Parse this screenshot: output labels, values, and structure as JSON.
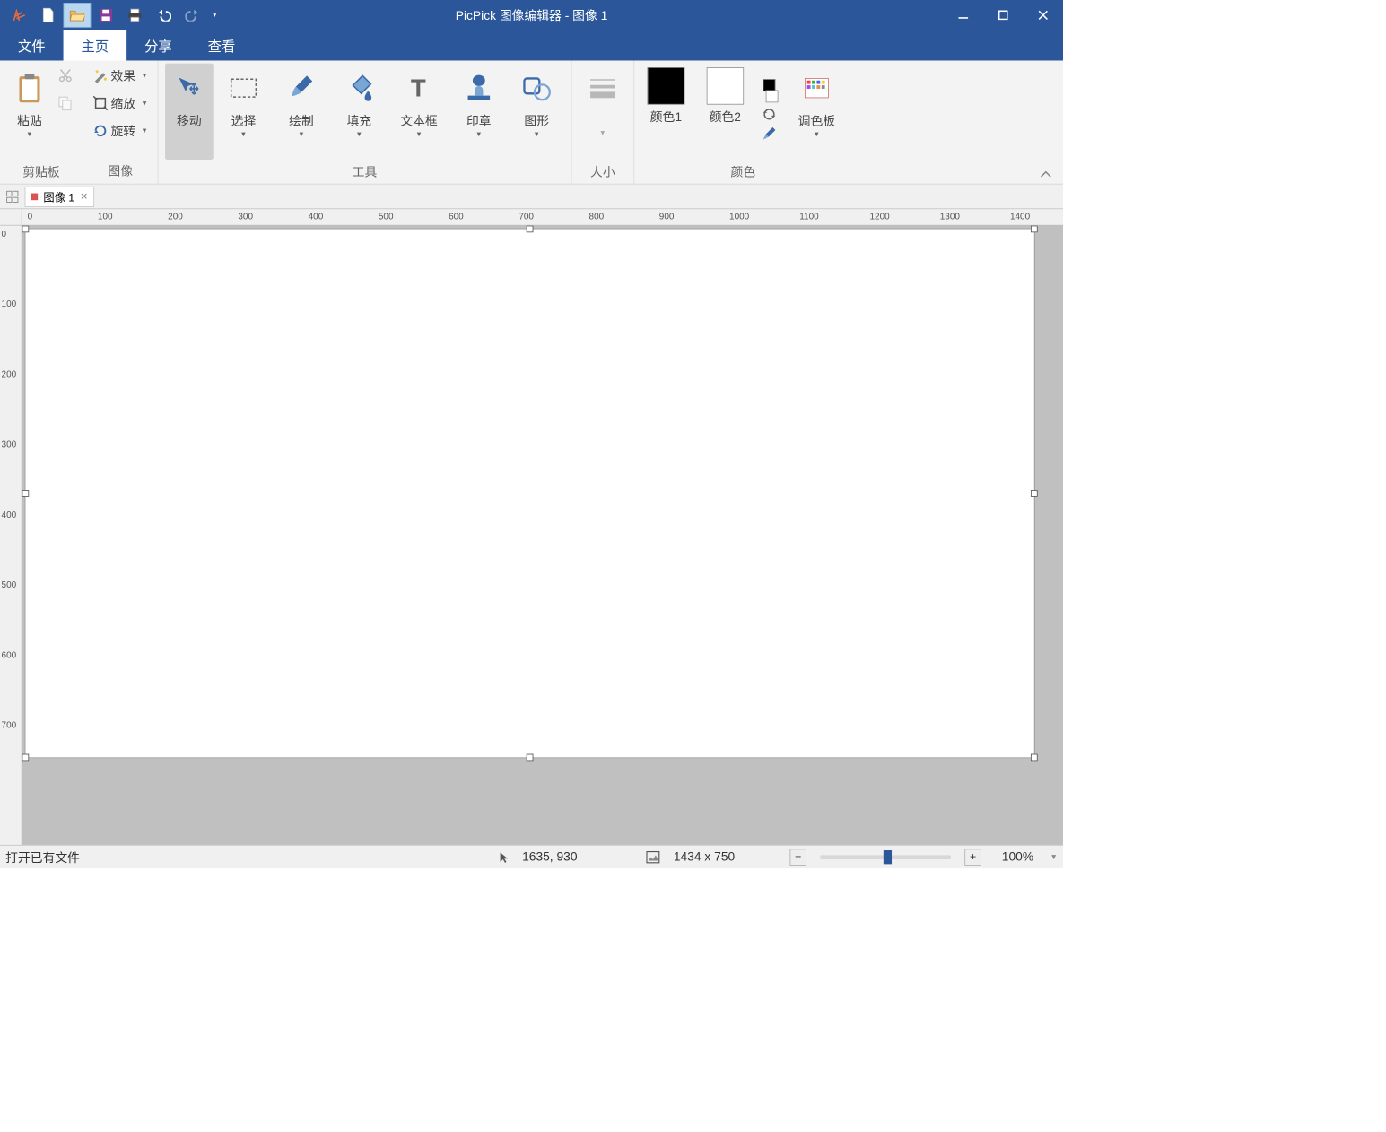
{
  "window": {
    "title": "PicPick 图像编辑器 - 图像 1"
  },
  "tabs": {
    "file": "文件",
    "home": "主页",
    "share": "分享",
    "view": "查看"
  },
  "ribbon": {
    "clipboard": {
      "paste": "粘贴",
      "group": "剪贴板"
    },
    "image": {
      "effects": "效果",
      "scale": "缩放",
      "rotate": "旋转",
      "group": "图像"
    },
    "tools": {
      "move": "移动",
      "select": "选择",
      "draw": "绘制",
      "fill": "填充",
      "textbox": "文本框",
      "stamp": "印章",
      "shape": "图形",
      "group": "工具"
    },
    "size": {
      "group": "大小"
    },
    "color": {
      "c1": "颜色1",
      "c2": "颜色2",
      "palette": "调色板",
      "group": "颜色"
    }
  },
  "doc_tab": {
    "label": "图像 1"
  },
  "status": {
    "hint": "打开已有文件",
    "cursor": "1635, 930",
    "dim": "1434 x 750",
    "zoom": "100%"
  },
  "ruler_h": [
    "0",
    "100",
    "200",
    "300",
    "400",
    "500",
    "600",
    "700",
    "800",
    "900",
    "1000",
    "1100",
    "1200",
    "1300",
    "1400"
  ],
  "ruler_v": [
    "0",
    "100",
    "200",
    "300",
    "400",
    "500",
    "600",
    "700"
  ]
}
